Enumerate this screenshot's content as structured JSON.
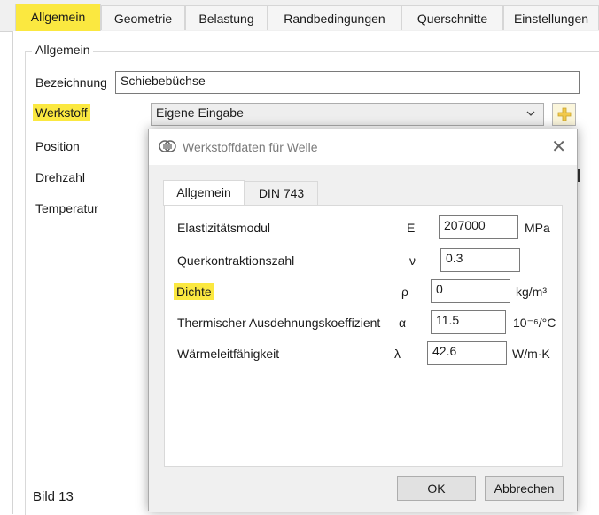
{
  "tabs": [
    "Allgemein",
    "Geometrie",
    "Belastung",
    "Randbedingungen",
    "Querschnitte",
    "Einstellungen"
  ],
  "group": {
    "title": "Allgemein"
  },
  "form": {
    "bezeichnung_label": "Bezeichnung",
    "bezeichnung_value": "Schiebebüchse",
    "werkstoff_label": "Werkstoff",
    "werkstoff_value": "Eigene Eingabe",
    "position_label": "Position",
    "drehzahl_label": "Drehzahl",
    "temperatur_label": "Temperatur"
  },
  "caption": "Bild 13",
  "dialog": {
    "title": "Werkstoffdaten für Welle",
    "close": "✕",
    "tabs": [
      "Allgemein",
      "DIN 743"
    ],
    "rows": [
      {
        "label": "Elastizitätsmodul",
        "symbol": "E",
        "value": "207000",
        "unit": "MPa"
      },
      {
        "label": "Querkontraktionszahl",
        "symbol": "ν",
        "value": "0.3",
        "unit": ""
      },
      {
        "label": "Dichte",
        "symbol": "ρ",
        "value": "0",
        "unit": "kg/m³"
      },
      {
        "label": "Thermischer Ausdehnungskoeffizient",
        "symbol": "α",
        "value": "11.5",
        "unit": "10⁻⁶/°C"
      },
      {
        "label": "Wärmeleitfähigkeit",
        "symbol": "λ",
        "value": "42.6",
        "unit": "W/m·K"
      }
    ],
    "ok": "OK",
    "cancel": "Abbrechen"
  },
  "colors": {
    "highlight": "#fbe840",
    "plus_icon": "#f2c94c"
  },
  "icons": {
    "dropdown": "chevron-down-icon",
    "add": "plus-icon",
    "dialog": "material-icon",
    "close": "close-icon"
  }
}
